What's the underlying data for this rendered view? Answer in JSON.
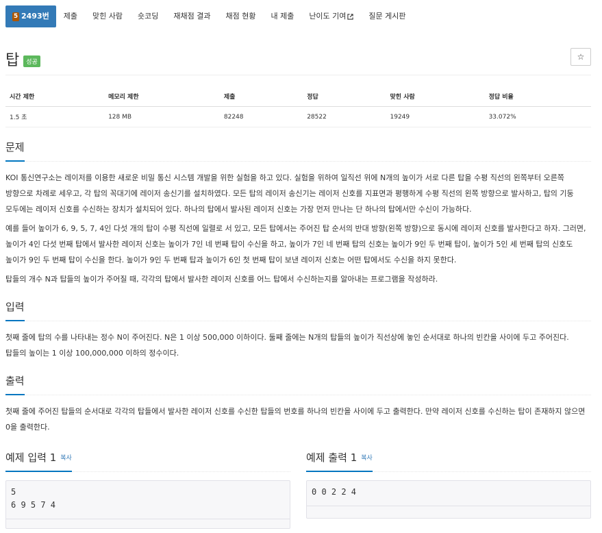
{
  "nav": {
    "problem_id": "2493번",
    "tier_label": "5",
    "tabs": [
      "제출",
      "맞힌 사람",
      "숏코딩",
      "재채점 결과",
      "채점 현황",
      "내 제출",
      "난이도 기여",
      "질문 게시판"
    ]
  },
  "problem": {
    "title": "탑",
    "status_badge": "성공",
    "star": "☆"
  },
  "stats": {
    "headers": [
      "시간 제한",
      "메모리 제한",
      "제출",
      "정답",
      "맞힌 사람",
      "정답 비율"
    ],
    "values": [
      "1.5 초",
      "128 MB",
      "82248",
      "28522",
      "19249",
      "33.072%"
    ]
  },
  "sections": {
    "description_title": "문제",
    "description": [
      "KOI 통신연구소는 레이저를 이용한 새로운 비밀 통신 시스템 개발을 위한 실험을 하고 있다. 실험을 위하여 일직선 위에 N개의 높이가 서로 다른 탑을 수평 직선의 왼쪽부터 오른쪽 방향으로 차례로 세우고, 각 탑의 꼭대기에 레이저 송신기를 설치하였다. 모든 탑의 레이저 송신기는 레이저 신호를 지표면과 평행하게 수평 직선의 왼쪽 방향으로 발사하고, 탑의 기둥 모두에는 레이저 신호를 수신하는 장치가 설치되어 있다. 하나의 탑에서 발사된 레이저 신호는 가장 먼저 만나는 단 하나의 탑에서만 수신이 가능하다.",
      "예를 들어 높이가 6, 9, 5, 7, 4인 다섯 개의 탑이 수평 직선에 일렬로 서 있고, 모든 탑에서는 주어진 탑 순서의 반대 방향(왼쪽 방향)으로 동시에 레이저 신호를 발사한다고 하자. 그러면, 높이가 4인 다섯 번째 탑에서 발사한 레이저 신호는 높이가 7인 네 번째 탑이 수신을 하고, 높이가 7인 네 번째 탑의 신호는 높이가 9인 두 번째 탑이, 높이가 5인 세 번째 탑의 신호도 높이가 9인 두 번째 탑이 수신을 한다. 높이가 9인 두 번째 탑과 높이가 6인 첫 번째 탑이 보낸 레이저 신호는 어떤 탑에서도 수신을 하지 못한다.",
      "탑들의 개수 N과 탑들의 높이가 주어질 때, 각각의 탑에서 발사한 레이저 신호를 어느 탑에서 수신하는지를 알아내는 프로그램을 작성하라."
    ],
    "input_title": "입력",
    "input": "첫째 줄에 탑의 수를 나타내는 정수 N이 주어진다. N은 1 이상 500,000 이하이다. 둘째 줄에는 N개의 탑들의 높이가 직선상에 놓인 순서대로 하나의 빈칸을 사이에 두고 주어진다. 탑들의 높이는 1 이상 100,000,000 이하의 정수이다.",
    "output_title": "출력",
    "output": "첫째 줄에 주어진 탑들의 순서대로 각각의 탑들에서 발사한 레이저 신호를 수신한 탑들의 번호를 하나의 빈칸을 사이에 두고 출력한다. 만약 레이저 신호를 수신하는 탑이 존재하지 않으면 0을 출력한다."
  },
  "samples": {
    "input_title": "예제 입력 1",
    "output_title": "예제 출력 1",
    "copy_label": "복사",
    "input_text": "5\n6 9 5 7 4",
    "output_text": "0 0 2 2 4"
  },
  "colors": {
    "accent": "#337ab7",
    "success": "#5cb85c",
    "underline": "#0076c0",
    "tier": "#ad5600"
  }
}
